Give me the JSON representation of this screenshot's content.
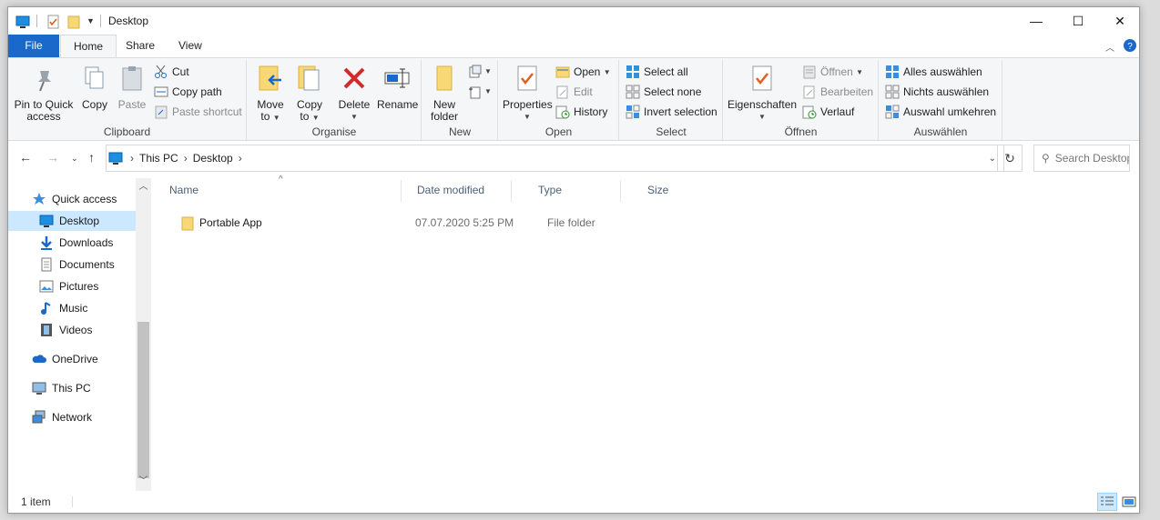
{
  "window": {
    "title": "Desktop",
    "controls": {
      "minimize": "—",
      "maximize": "☐",
      "close": "✕"
    }
  },
  "tabs": [
    {
      "label": "File"
    },
    {
      "label": "Home"
    },
    {
      "label": "Share"
    },
    {
      "label": "View"
    }
  ],
  "ribbon": {
    "clipboard": {
      "label": "Clipboard",
      "pin": "Pin to Quick access",
      "copy": "Copy",
      "paste": "Paste",
      "cut": "Cut",
      "copy_path": "Copy path",
      "paste_shortcut": "Paste shortcut"
    },
    "organise": {
      "label": "Organise",
      "move_to": "Move to",
      "copy_to": "Copy to",
      "delete": "Delete",
      "rename": "Rename"
    },
    "new": {
      "label": "New",
      "new_folder": "New folder"
    },
    "open": {
      "label": "Open",
      "properties": "Properties",
      "open": "Open",
      "edit": "Edit",
      "history": "History"
    },
    "select": {
      "label": "Select",
      "select_all": "Select all",
      "select_none": "Select none",
      "invert": "Invert selection"
    },
    "oeffnen": {
      "label": "Öffnen",
      "eigenschaften": "Eigenschaften",
      "oeffnen": "Öffnen",
      "bearbeiten": "Bearbeiten",
      "verlauf": "Verlauf"
    },
    "auswaehlen": {
      "label": "Auswählen",
      "alles": "Alles auswählen",
      "nichts": "Nichts auswählen",
      "umkehren": "Auswahl umkehren"
    }
  },
  "address": {
    "crumbs": [
      "This PC",
      "Desktop"
    ],
    "search_placeholder": "Search Desktop"
  },
  "nav": {
    "items": [
      {
        "label": "Quick access",
        "icon": "star-icon"
      },
      {
        "label": "Desktop",
        "icon": "desktop-icon"
      },
      {
        "label": "Downloads",
        "icon": "download-icon"
      },
      {
        "label": "Documents",
        "icon": "documents-icon"
      },
      {
        "label": "Pictures",
        "icon": "pictures-icon"
      },
      {
        "label": "Music",
        "icon": "music-icon"
      },
      {
        "label": "Videos",
        "icon": "videos-icon"
      },
      {
        "label": "OneDrive",
        "icon": "cloud-icon"
      },
      {
        "label": "This PC",
        "icon": "computer-icon"
      },
      {
        "label": "Network",
        "icon": "network-icon"
      }
    ]
  },
  "filelist": {
    "columns": [
      "Name",
      "Date modified",
      "Type",
      "Size"
    ],
    "rows": [
      {
        "name": "Portable App",
        "date": "07.07.2020 5:25 PM",
        "type": "File folder",
        "size": ""
      }
    ]
  },
  "status": {
    "count": "1 item"
  },
  "colors": {
    "accent": "#1a68c9",
    "selection": "#cce8ff",
    "folder": "#f8d775"
  }
}
